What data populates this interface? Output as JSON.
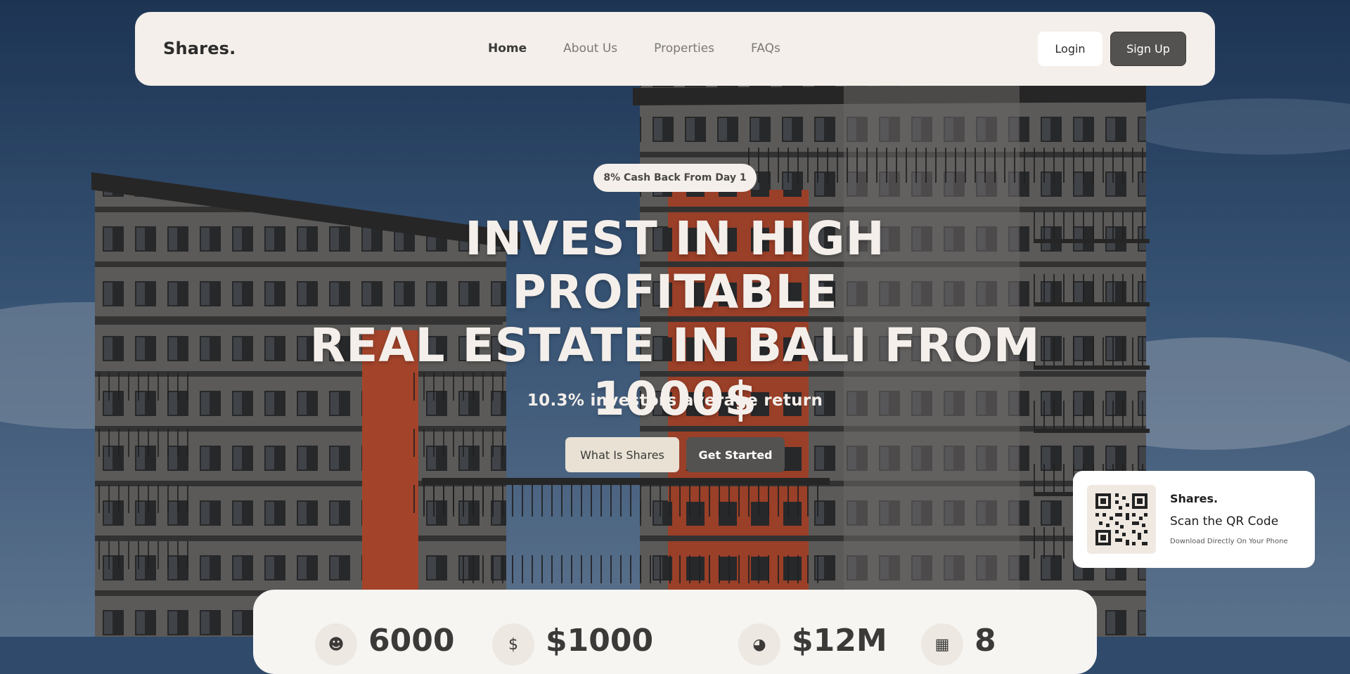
{
  "nav": {
    "brand": "Shares",
    "brand_dot": ".",
    "links": [
      "Home",
      "About Us",
      "Properties",
      "FAQs"
    ],
    "active_link": "Home",
    "login_label": "Login",
    "signup_label": "Sign Up"
  },
  "hero": {
    "badge": "8% Cash Back From Day 1",
    "title_line1": "INVEST IN HIGH PROFITABLE",
    "title_line2": "REAL ESTATE IN BALI FROM",
    "title_line3": "1000$",
    "subtitle": "10.3% investors average return",
    "primary_button": "What Is Shares",
    "secondary_button": "Get Started"
  },
  "qr_card": {
    "brand": "Shares",
    "brand_dot": ".",
    "title": "Scan the QR Code",
    "note": "Download Directly On Your Phone"
  },
  "stats": [
    {
      "icon": "user-icon",
      "value": "6000"
    },
    {
      "icon": "dollar-icon",
      "value": "$1000"
    },
    {
      "icon": "chart-icon",
      "value": "$12M"
    },
    {
      "icon": "building-icon",
      "value": "8"
    }
  ],
  "colors": {
    "accent_dark": "#535250",
    "cream": "#f4efea",
    "sky": "#2f4a6b",
    "brick": "#c9502d"
  }
}
